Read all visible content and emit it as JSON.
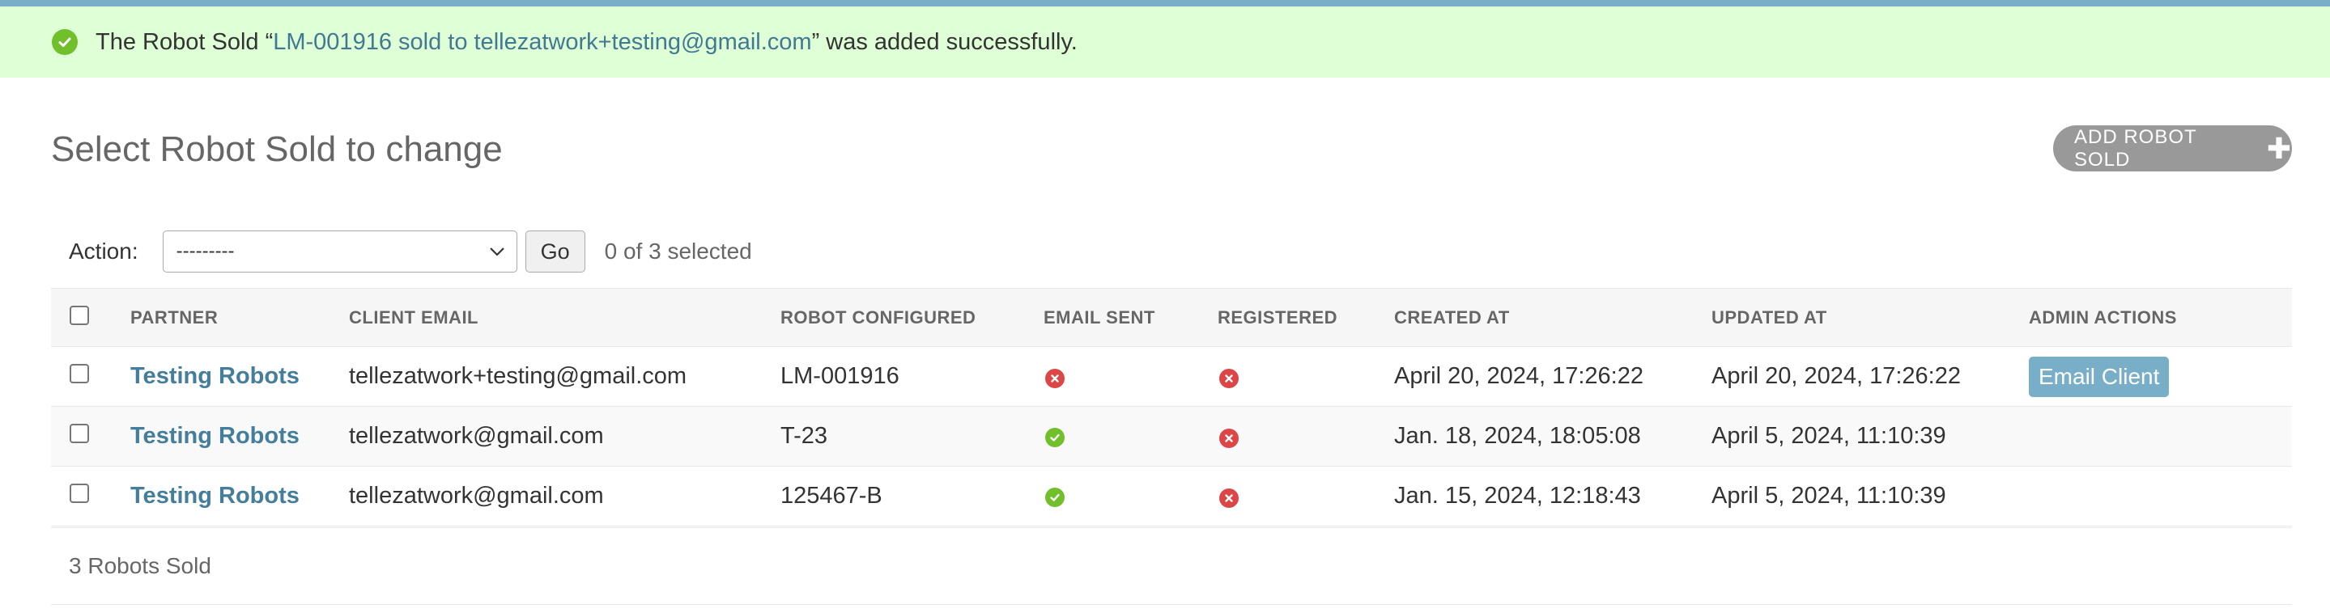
{
  "message": {
    "prefix": "The Robot Sold “",
    "link_text": "LM-001916 sold to tellezatwork+testing@gmail.com",
    "suffix": "” was added successfully."
  },
  "page_title": "Select Robot Sold to change",
  "add_button": {
    "label": "ADD ROBOT SOLD",
    "icon": "plus-icon"
  },
  "actions": {
    "label": "Action:",
    "selected_option": "---------",
    "go_label": "Go",
    "selection_count": "0 of 3 selected"
  },
  "table": {
    "headers": {
      "partner": "PARTNER",
      "client_email": "CLIENT EMAIL",
      "robot_configured": "ROBOT CONFIGURED",
      "email_sent": "EMAIL SENT",
      "registered": "REGISTERED",
      "created_at": "CREATED AT",
      "updated_at": "UPDATED AT",
      "admin_actions": "ADMIN ACTIONS"
    },
    "rows": [
      {
        "partner": "Testing Robots",
        "client_email": "tellezatwork+testing@gmail.com",
        "robot_configured": "LM-001916",
        "email_sent": false,
        "registered": false,
        "created_at": "April 20, 2024, 17:26:22",
        "updated_at": "April 20, 2024, 17:26:22",
        "admin_action": "Email Client"
      },
      {
        "partner": "Testing Robots",
        "client_email": "tellezatwork@gmail.com",
        "robot_configured": "T-23",
        "email_sent": true,
        "registered": false,
        "created_at": "Jan. 18, 2024, 18:05:08",
        "updated_at": "April 5, 2024, 11:10:39",
        "admin_action": ""
      },
      {
        "partner": "Testing Robots",
        "client_email": "tellezatwork@gmail.com",
        "robot_configured": "125467-B",
        "email_sent": true,
        "registered": false,
        "created_at": "Jan. 15, 2024, 12:18:43",
        "updated_at": "April 5, 2024, 11:10:39",
        "admin_action": ""
      }
    ]
  },
  "result_count": "3 Robots Sold",
  "colors": {
    "success_bg": "#dfffd7",
    "success_icon": "#70bf2b",
    "error_icon": "#dd4646",
    "link": "#447e9b",
    "accent": "#79aec8",
    "add_button_bg": "#999999"
  }
}
